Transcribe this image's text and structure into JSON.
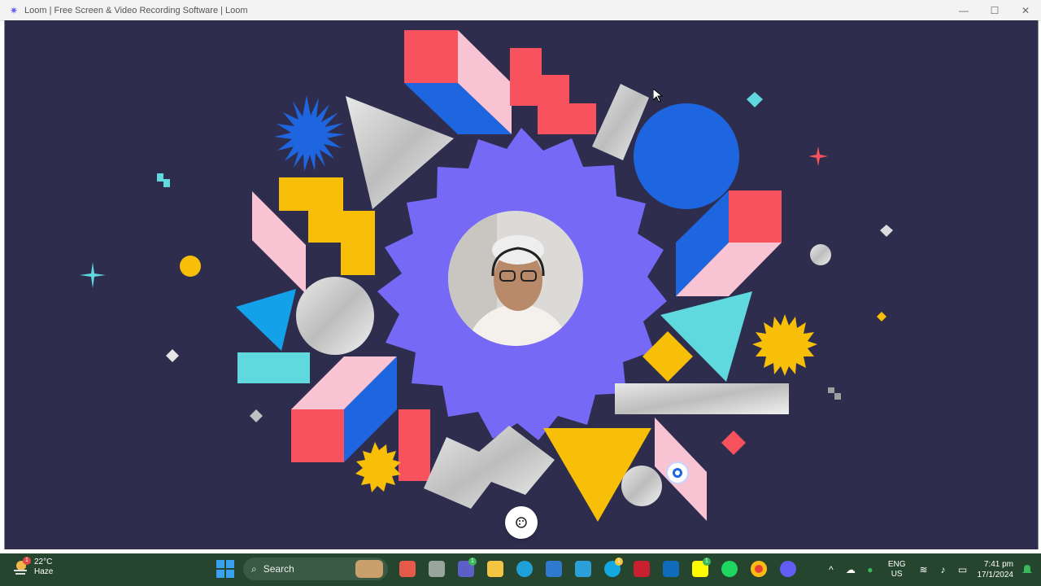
{
  "window": {
    "title": "Loom | Free Screen & Video Recording Software | Loom",
    "controls": {
      "minimize": "—",
      "maximize": "☐",
      "close": "✕"
    }
  },
  "colors": {
    "background": "#2f2d4e",
    "starburst": "#7669f6",
    "coral": "#f8525f",
    "pink": "#f8c3d2",
    "blue": "#1d66e0",
    "yellow": "#f7bf07",
    "teal": "#5fd8de",
    "taskbar": "#26452f"
  },
  "stage": {
    "theme_button_icon": "palette-icon",
    "loom_bubble_icon": "loom-logo-icon"
  },
  "taskbar": {
    "weather": {
      "temp": "22°C",
      "condition": "Haze",
      "badge": "1"
    },
    "search_label": "Search",
    "apps": [
      {
        "name": "file-explorer-icon"
      },
      {
        "name": "teams-icon",
        "badge": "1"
      },
      {
        "name": "folder-icon"
      },
      {
        "name": "edge-icon"
      },
      {
        "name": "store-icon"
      },
      {
        "name": "mdp-icon"
      },
      {
        "name": "skype-icon",
        "badge": "1"
      },
      {
        "name": "mcafee-icon"
      },
      {
        "name": "outlook-icon"
      },
      {
        "name": "snapchat-icon",
        "badge": "1"
      },
      {
        "name": "spotify-icon"
      },
      {
        "name": "chrome-icon"
      },
      {
        "name": "loom-app-icon"
      }
    ],
    "tray": {
      "lang_top": "ENG",
      "lang_bottom": "US",
      "time": "7:41 pm",
      "date": "17/1/2024"
    }
  }
}
